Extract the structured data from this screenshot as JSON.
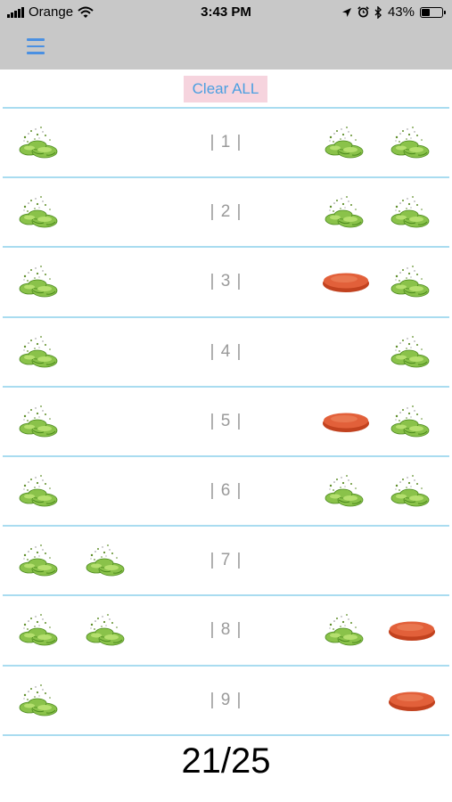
{
  "status_bar": {
    "carrier": "Orange",
    "time": "3:43 PM",
    "battery_percent": "43%",
    "battery_level": 0.43,
    "icons": [
      "signal-bars-icon",
      "wifi-icon",
      "location-arrow-icon",
      "alarm-clock-icon",
      "bluetooth-icon",
      "battery-icon"
    ]
  },
  "nav": {
    "menu_icon": "hamburger-menu-icon"
  },
  "clear_all_label": "Clear ALL",
  "rows": [
    {
      "label": "| 1 |",
      "cells": [
        "broken",
        null,
        "broken",
        "broken"
      ]
    },
    {
      "label": "| 2 |",
      "cells": [
        "broken",
        null,
        "broken",
        "broken"
      ]
    },
    {
      "label": "| 3 |",
      "cells": [
        "broken",
        null,
        "whole",
        "broken"
      ]
    },
    {
      "label": "| 4 |",
      "cells": [
        "broken",
        null,
        null,
        "broken"
      ]
    },
    {
      "label": "| 5 |",
      "cells": [
        "broken",
        null,
        "whole",
        "broken"
      ]
    },
    {
      "label": "| 6 |",
      "cells": [
        "broken",
        null,
        "broken",
        "broken"
      ]
    },
    {
      "label": "| 7 |",
      "cells": [
        "broken",
        "broken",
        null,
        null
      ]
    },
    {
      "label": "| 8 |",
      "cells": [
        "broken",
        "broken",
        "broken",
        "whole"
      ]
    },
    {
      "label": "| 9 |",
      "cells": [
        "broken",
        null,
        null,
        "whole"
      ]
    }
  ],
  "score": "21/25",
  "colors": {
    "bar_background": "#c8c8c8",
    "accent_blue": "#4a90e2",
    "separator": "#a9dcf0",
    "clear_button_bg": "#f6d4de",
    "label_gray": "#9a9a9a",
    "broken_target_green": "#7ab53a",
    "whole_target_orange": "#d8502a"
  },
  "legend_icons": {
    "broken": "broken-clay-target-icon",
    "whole": "whole-clay-target-icon"
  }
}
